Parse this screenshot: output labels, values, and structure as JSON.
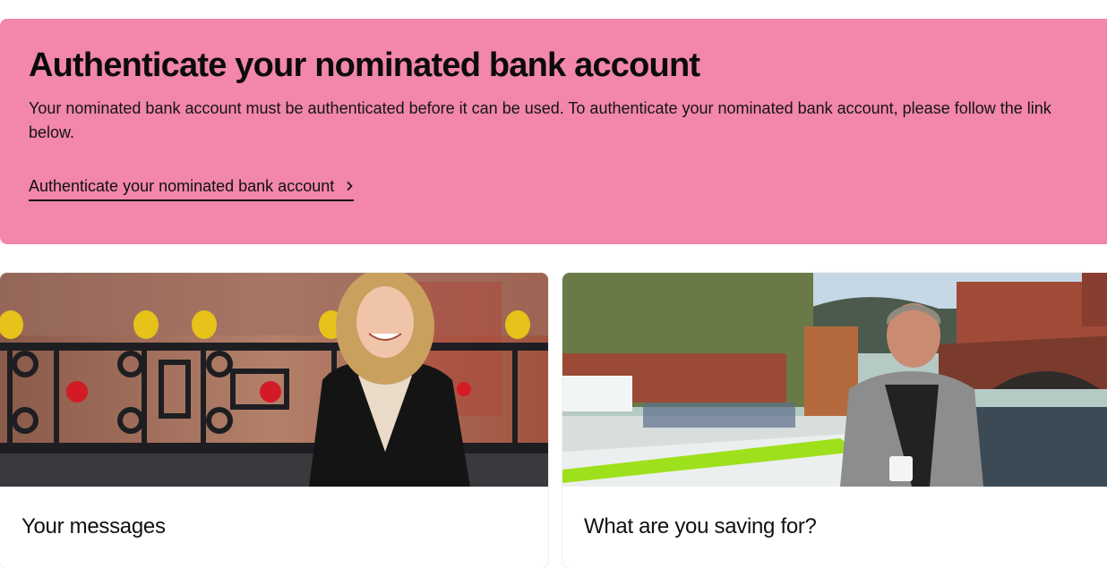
{
  "banner": {
    "title": "Authenticate your nominated bank account",
    "description": "Your nominated bank account must be authenticated before it can be used. To authenticate your nominated bank account, please follow the link below.",
    "link_label": "Authenticate your nominated bank account",
    "background": "#f286ac"
  },
  "cards": [
    {
      "title": "Your messages",
      "image": "woman-smiling-by-railings-photo"
    },
    {
      "title": "What are you saving for?",
      "image": "man-on-canal-boat-photo"
    }
  ],
  "icons": {
    "link_arrow": "chevron-right-icon"
  }
}
